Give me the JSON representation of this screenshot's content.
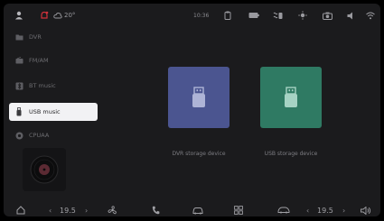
{
  "status_bar": {
    "temperature": "20°",
    "time": "10:36",
    "icons": [
      "person-icon",
      "bell-alert-icon",
      "cloud-icon",
      "clipboard-icon",
      "battery-icon",
      "seat-heat-icon",
      "sun-icon",
      "camera-icon",
      "volume-icon",
      "wifi-icon"
    ]
  },
  "sidebar": {
    "items": [
      {
        "label": "DVR",
        "icon": "folder-icon",
        "active": false
      },
      {
        "label": "FM/AM",
        "icon": "radio-icon",
        "active": false
      },
      {
        "label": "BT music",
        "icon": "bt-music-icon",
        "active": false
      },
      {
        "label": "USB music",
        "icon": "usb-icon",
        "active": true
      },
      {
        "label": "CPUAA",
        "icon": "cp-icon",
        "active": false
      }
    ]
  },
  "devices": [
    {
      "label": "DVR storage device",
      "color": "#4b5590"
    },
    {
      "label": "USB storage device",
      "color": "#2f7a63"
    }
  ],
  "bottom_bar": {
    "left_temp": "19.5",
    "right_temp": "19.5",
    "icons": [
      "home-icon",
      "fan-icon",
      "phone-icon",
      "car-icon",
      "grid-icon",
      "climate-car-icon",
      "volume-icon"
    ]
  }
}
